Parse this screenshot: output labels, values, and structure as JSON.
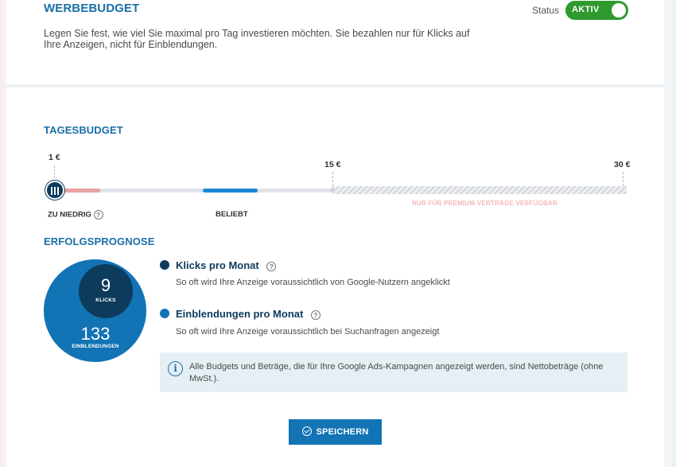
{
  "header": {
    "title": "WERBEBUDGET",
    "description": "Legen Sie fest, wie viel Sie maximal pro Tag investieren möchten. Sie bezahlen nur für Klicks auf Ihre Anzeigen, nicht für Einblendungen.",
    "status_label": "Status",
    "status_toggle": "AKTIV"
  },
  "daily_budget": {
    "title": "TAGESBUDGET",
    "min_label": "1 €",
    "mid_label": "15 €",
    "max_label": "30 €",
    "too_low_label": "ZU NIEDRIG",
    "popular_label": "BELIEBT",
    "premium_note": "NUR FÜR PREMIUM-VERTRÄGE VERFÜGBAR",
    "selected_value": 1,
    "colors": {
      "too_low": "#e8a3a3",
      "popular": "#1e88d8",
      "track": "#dfe3e8"
    }
  },
  "forecast": {
    "title": "ERFOLGSPROGNOSE",
    "clicks_value": "9",
    "clicks_label": "KLICKS",
    "impressions_value": "133",
    "impressions_label": "EINBLENDUNGEN",
    "legend": [
      {
        "title": "Klicks pro Monat",
        "desc": "So oft wird Ihre Anzeige voraussichtlich von Google-Nutzern angeklickt",
        "color": "#0d3b5c"
      },
      {
        "title": "Einblendungen pro Monat",
        "desc": "So oft wird Ihre Anzeige voraussichtlich bei Suchanfragen angezeigt",
        "color": "#1273b5"
      }
    ],
    "info_text": "Alle Budgets und Beträge, die für Ihre Google Ads-Kampagnen angezeigt werden, sind Nettobeträge (ohne MwSt.)."
  },
  "save_button": "SPEICHERN"
}
